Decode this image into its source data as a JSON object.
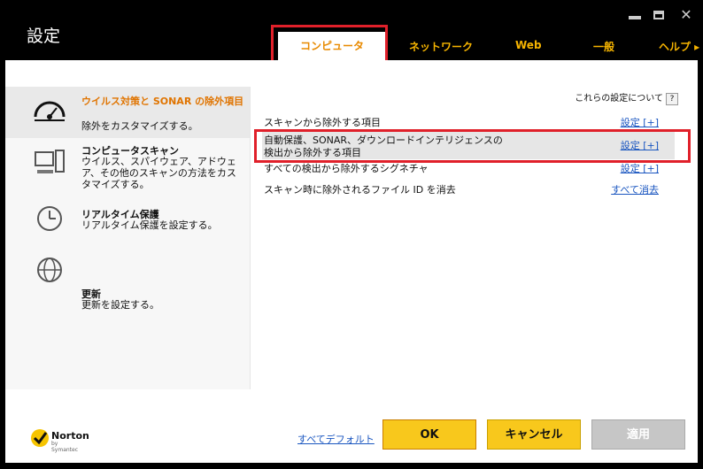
{
  "window": {
    "title": "設定",
    "minimize_label": "",
    "maximize_label": "",
    "close_label": "✕"
  },
  "tabs": [
    {
      "label": "コンピュータ"
    },
    {
      "label": "ネットワーク"
    },
    {
      "label": "Web"
    },
    {
      "label": "一般"
    },
    {
      "label": "ヘルプ ▸"
    }
  ],
  "sidebar": {
    "items": [
      {
        "icon": "gauge-icon",
        "title": "ウイルス対策と SONAR の除外項目",
        "desc": "除外をカスタマイズする。"
      },
      {
        "icon": "computer-icon",
        "title": "コンピュータスキャン",
        "desc": "ウイルス、スパイウェア、アドウェア、その他のスキャンの方法をカスタマイズする。"
      },
      {
        "icon": "clock-icon",
        "title": "リアルタイム保護",
        "desc": "リアルタイム保護を設定する。"
      },
      {
        "icon": "globe-update-icon",
        "title": "更新",
        "desc": "更新を設定する。"
      }
    ]
  },
  "content": {
    "help_text": "これらの設定について",
    "help_icon": "?",
    "rows": [
      {
        "label": "スキャンから除外する項目",
        "link": "設定 [+]"
      },
      {
        "label1": "自動保護、SONAR、ダウンロードインテリジェンスの",
        "label2": "検出から除外する項目",
        "link": "設定 [+]"
      },
      {
        "label": "すべての検出から除外するシグネチャ",
        "link": "設定 [+]"
      },
      {
        "label": "スキャン時に除外されるファイル ID を消去",
        "link": "すべて消去"
      }
    ]
  },
  "footer": {
    "brand": "Norton",
    "brand_sub": "by Symantec",
    "defaults_link": "すべてデフォルト",
    "ok": "OK",
    "cancel": "キャンセル",
    "apply": "適用"
  },
  "colors": {
    "accent": "#f6b400",
    "highlight_red": "#e0202a",
    "link": "#1a56c0"
  }
}
